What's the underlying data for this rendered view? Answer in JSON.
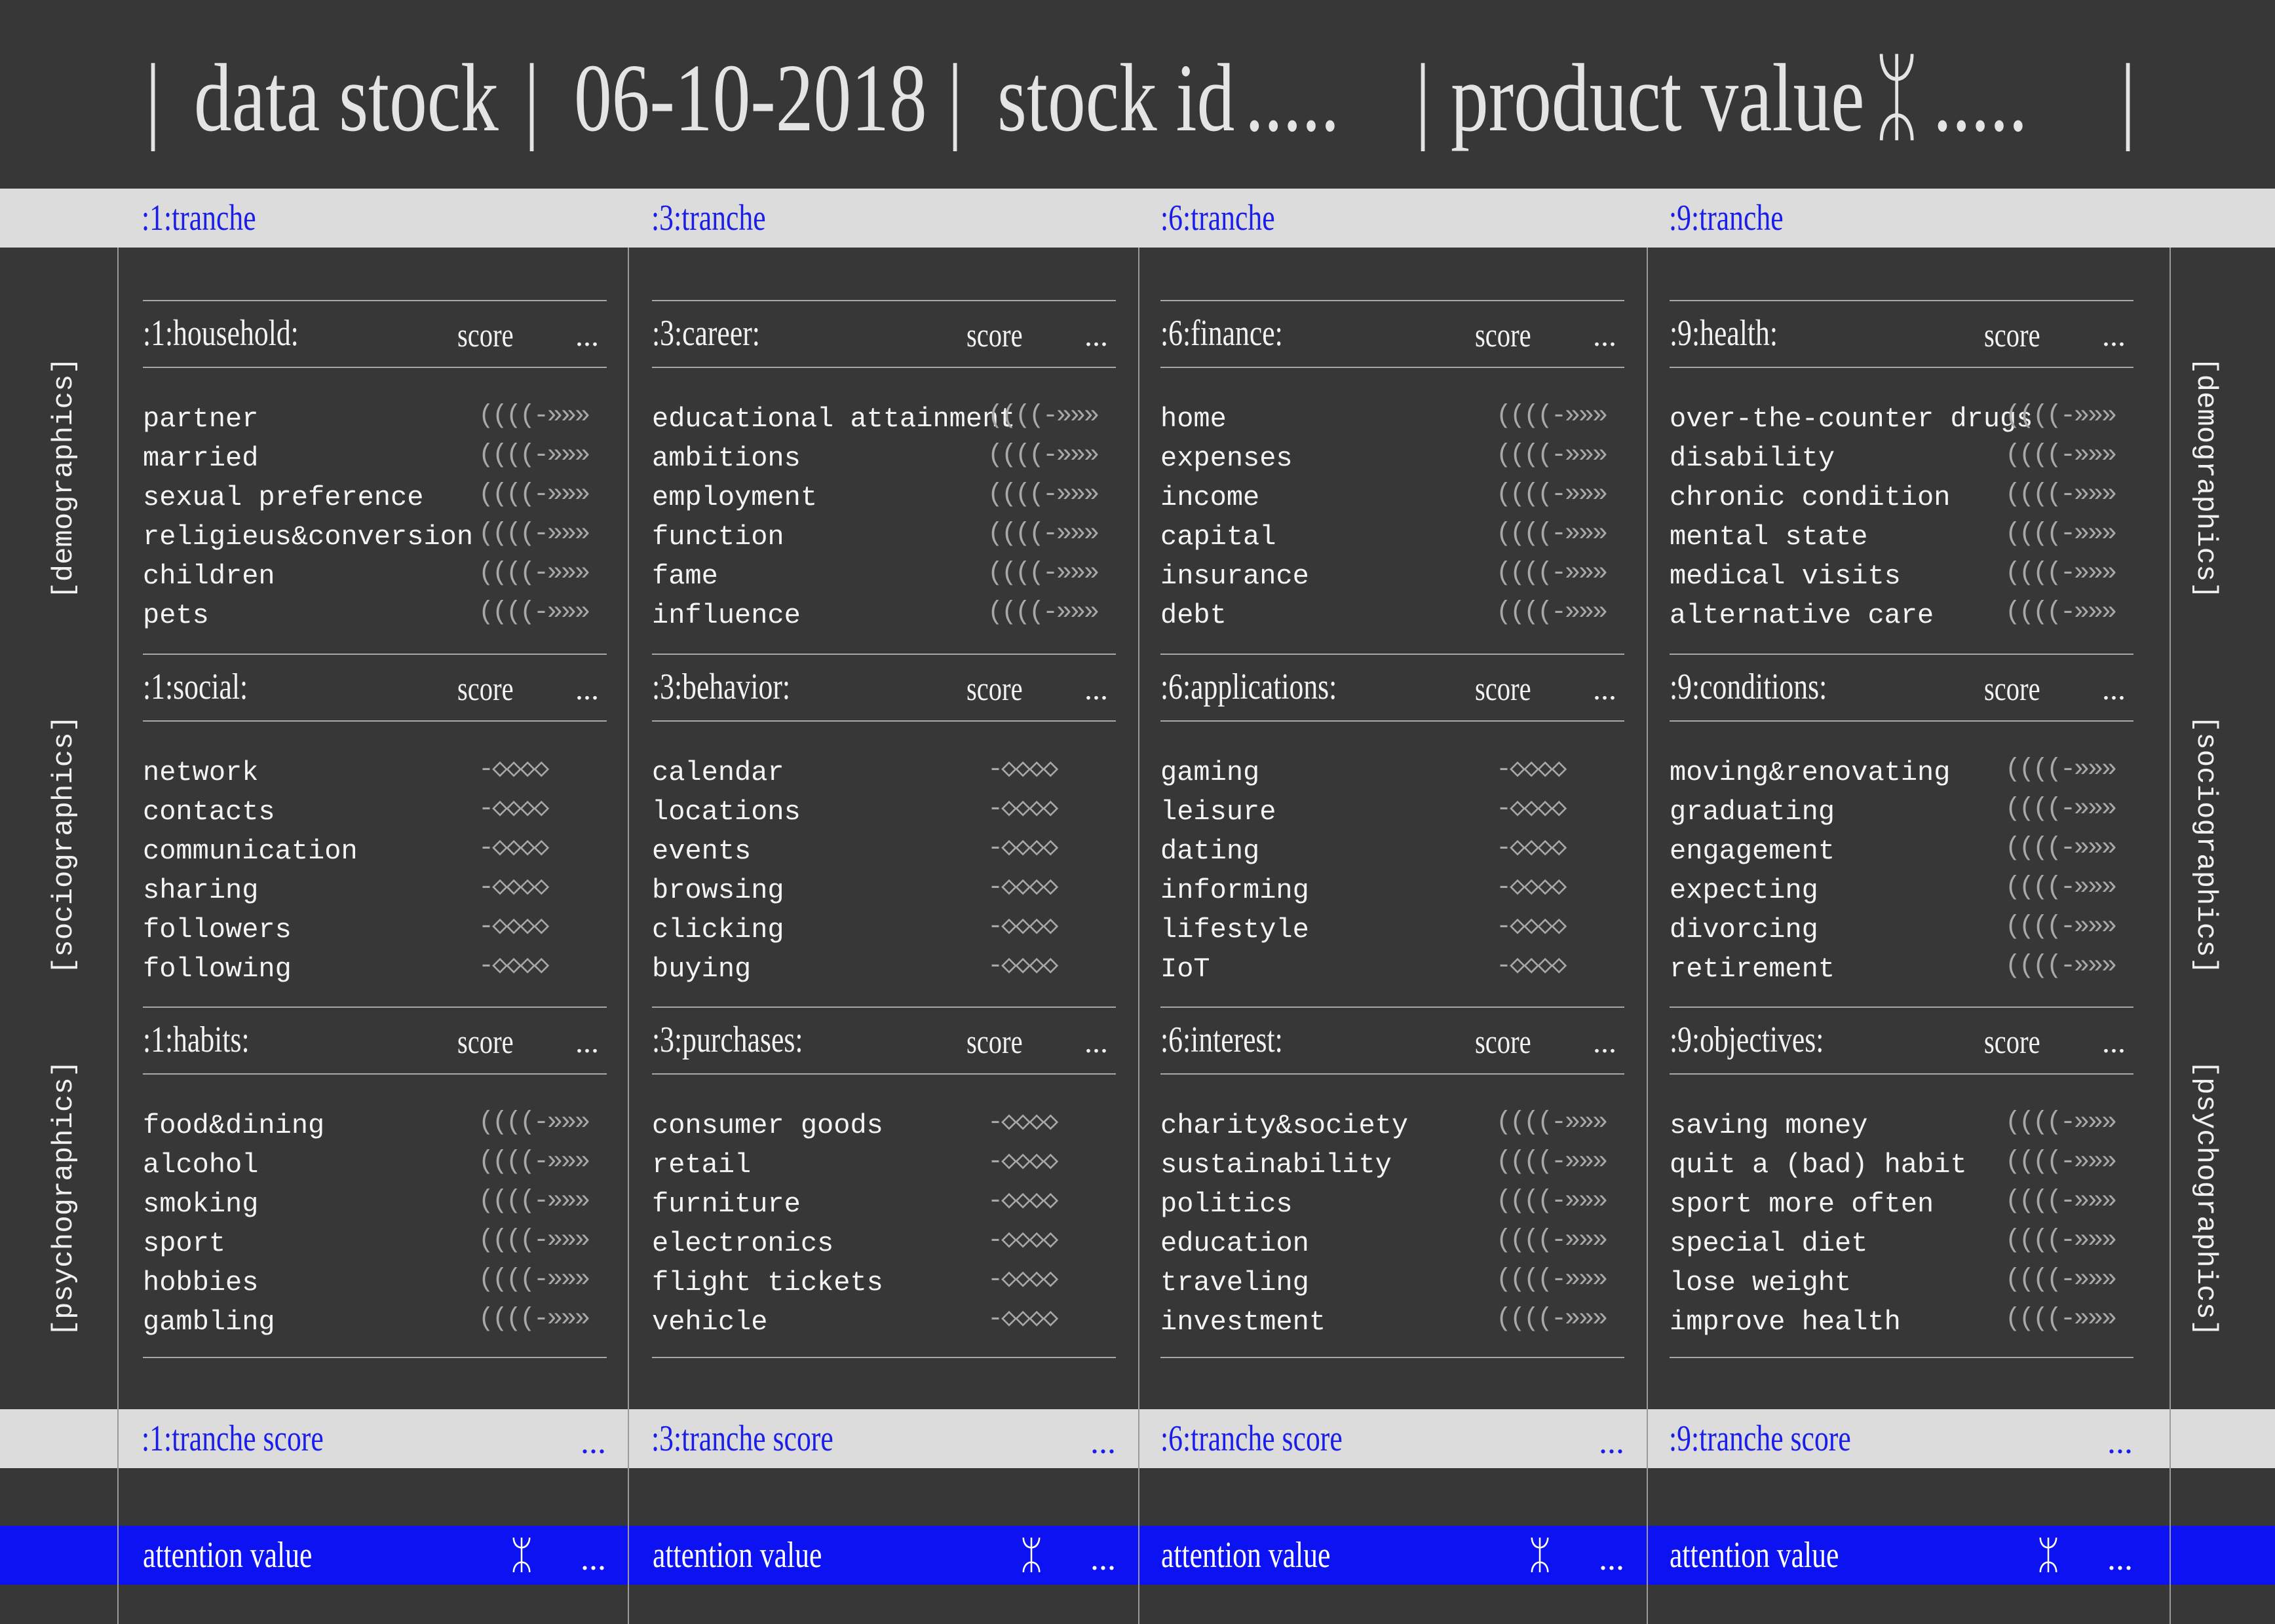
{
  "header": {
    "bar": "|",
    "title": "data stock",
    "date": "06-10-2018",
    "stock_id_label": "stock id",
    "stock_id_value": ".....",
    "product_value_label": "product value",
    "currency_symbol": "ᛯ",
    "product_value": "....."
  },
  "side_labels": [
    "[demographics]",
    "[sociographics]",
    "[psychographics]"
  ],
  "score_label": "score",
  "dots": "...",
  "attention_label": "attention value",
  "attention_symbol": "ᛯ",
  "score_glyphs": {
    "in_out": "((((-»»»",
    "diamonds": "-◇◇◇◇"
  },
  "columns": [
    {
      "tranche": ":1:tranche",
      "tranche_score": ":1:tranche score",
      "sections": [
        {
          "title": ":1:household:",
          "glyph": "in_out",
          "items": [
            "partner",
            "married",
            "sexual preference",
            "religieus&conversion",
            "children",
            "pets"
          ]
        },
        {
          "title": ":1:social:",
          "glyph": "diamonds",
          "items": [
            "network",
            "contacts",
            "communication",
            "sharing",
            "followers",
            "following"
          ]
        },
        {
          "title": ":1:habits:",
          "glyph": "in_out",
          "items": [
            "food&dining",
            "alcohol",
            "smoking",
            "sport",
            "hobbies",
            "gambling"
          ]
        }
      ]
    },
    {
      "tranche": ":3:tranche",
      "tranche_score": ":3:tranche score",
      "sections": [
        {
          "title": ":3:career:",
          "glyph": "in_out",
          "items": [
            "educational attainment",
            "ambitions",
            "employment",
            "function",
            "fame",
            "influence"
          ]
        },
        {
          "title": ":3:behavior:",
          "glyph": "diamonds",
          "items": [
            "calendar",
            "locations",
            "events",
            "browsing",
            "clicking",
            "buying"
          ]
        },
        {
          "title": ":3:purchases:",
          "glyph": "diamonds",
          "items": [
            "consumer goods",
            "retail",
            "furniture",
            "electronics",
            "flight tickets",
            "vehicle"
          ]
        }
      ]
    },
    {
      "tranche": ":6:tranche",
      "tranche_score": ":6:tranche score",
      "sections": [
        {
          "title": ":6:finance:",
          "glyph": "in_out",
          "items": [
            "home",
            "expenses",
            "income",
            "capital",
            "insurance",
            "debt"
          ]
        },
        {
          "title": ":6:applications:",
          "glyph": "diamonds",
          "items": [
            "gaming",
            "leisure",
            "dating",
            "informing",
            "lifestyle",
            "IoT"
          ]
        },
        {
          "title": ":6:interest:",
          "glyph": "in_out",
          "items": [
            "charity&society",
            "sustainability",
            "politics",
            "education",
            "traveling",
            "investment"
          ]
        }
      ]
    },
    {
      "tranche": ":9:tranche",
      "tranche_score": ":9:tranche score",
      "sections": [
        {
          "title": ":9:health:",
          "glyph": "in_out",
          "items": [
            "over-the-counter drugs",
            "disability",
            "chronic condition",
            "mental state",
            "medical visits",
            "alternative care"
          ]
        },
        {
          "title": ":9:conditions:",
          "glyph": "in_out",
          "items": [
            "moving&renovating",
            "graduating",
            "engagement",
            "expecting",
            "divorcing",
            "retirement"
          ]
        },
        {
          "title": ":9:objectives:",
          "glyph": "in_out",
          "items": [
            "saving money",
            "quit a (bad) habit",
            "sport more often",
            "special diet",
            "lose weight",
            "improve health"
          ]
        }
      ]
    }
  ],
  "colors": {
    "background": "#373737",
    "band": "#dcdcdc",
    "accent_blue": "#0c12f2",
    "text": "#f2f2f2",
    "muted": "#a8a8a8"
  }
}
